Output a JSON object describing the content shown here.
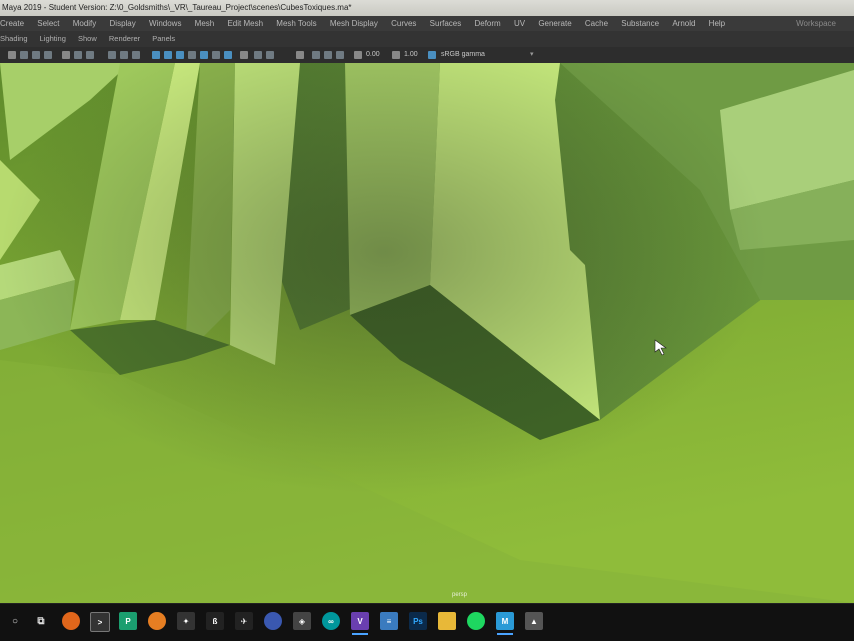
{
  "window": {
    "title": "Maya 2019 - Student Version: Z:\\0_Goldsmiths\\_VR\\_Taureau_Project\\scenes\\CubesToxiques.ma*"
  },
  "menubar": {
    "items": [
      "Create",
      "Select",
      "Modify",
      "Display",
      "Windows",
      "Mesh",
      "Edit Mesh",
      "Mesh Tools",
      "Mesh Display",
      "Curves",
      "Surfaces",
      "Deform",
      "UV",
      "Generate",
      "Cache",
      "Substance",
      "Arnold",
      "Help"
    ],
    "workspace_label": "Workspace"
  },
  "panel_menu": {
    "items": [
      "Shading",
      "Lighting",
      "Show",
      "Renderer",
      "Panels"
    ]
  },
  "viewport_toolbar": {
    "exposure_value": "0.00",
    "gamma_value": "1.00",
    "color_space": "sRGB gamma"
  },
  "viewport": {
    "camera_label": "persp",
    "accent_color": "#c3e86f"
  },
  "taskbar": {
    "icons": [
      "search-icon",
      "task-view-icon",
      "firefox-icon",
      "terminal-icon",
      "pycharm-icon",
      "blender-icon",
      "app-icon",
      "git-icon",
      "inkscape-icon",
      "app-icon-2",
      "unity-icon",
      "arduino-icon",
      "visual-studio-icon",
      "notepad-icon",
      "photoshop-icon",
      "file-explorer-icon",
      "spotify-icon",
      "maya-icon",
      "photos-icon"
    ]
  }
}
